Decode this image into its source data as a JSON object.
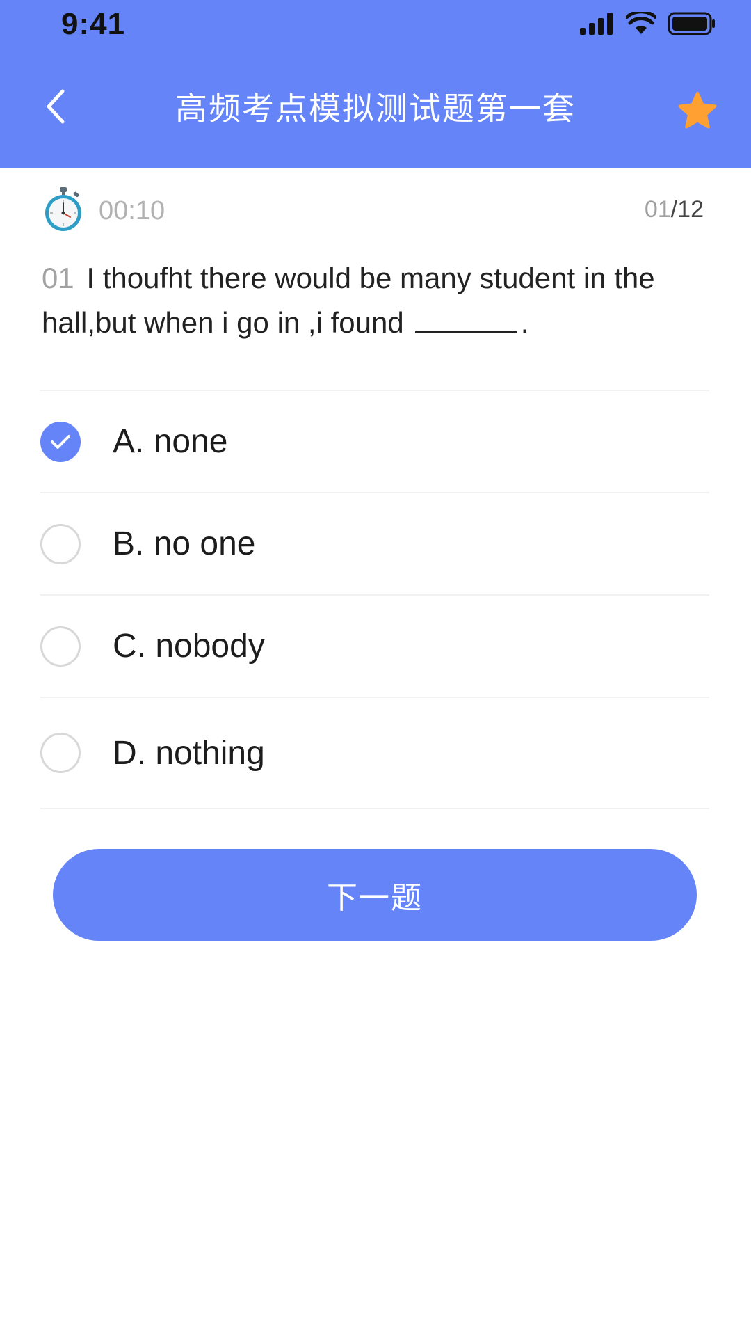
{
  "status_bar": {
    "time": "9:41"
  },
  "nav": {
    "title": "高频考点模拟测试题第一套",
    "back_icon": "chevron-left-icon",
    "favorite_icon": "star-icon"
  },
  "quiz": {
    "timer": "00:10",
    "progress_current": "01",
    "progress_separator": "/",
    "progress_total": "12",
    "question_number": "01",
    "question_text": "I thoufht there would be many student in the hall,but when i go in ,i found",
    "question_end": "."
  },
  "options": [
    {
      "label": "A. none",
      "selected": true
    },
    {
      "label": "B. no one",
      "selected": false
    },
    {
      "label": "C. nobody",
      "selected": false
    },
    {
      "label": "D. nothing",
      "selected": false
    }
  ],
  "next_button": {
    "label": "下一题"
  },
  "colors": {
    "primary": "#6584f7",
    "star": "#ffa032"
  }
}
